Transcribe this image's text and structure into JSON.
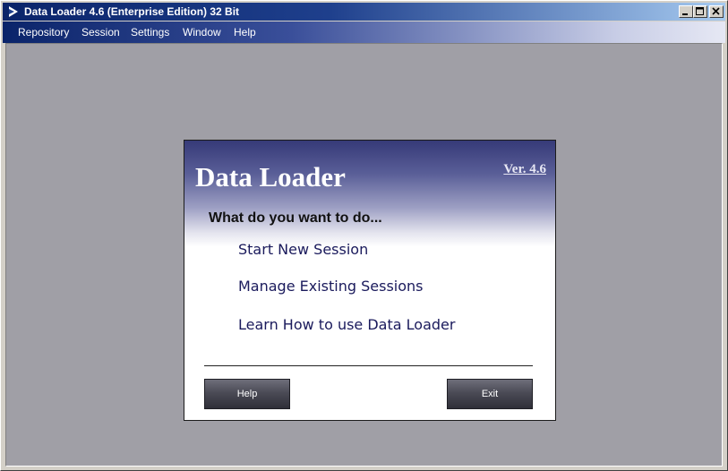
{
  "window": {
    "title": "Data Loader 4.6 (Enterprise Edition) 32 Bit",
    "controls": {
      "minimize": "_",
      "maximize": "□",
      "close": "X"
    }
  },
  "menu": [
    "Repository",
    "Session",
    "Settings",
    "Window",
    "Help"
  ],
  "dialog": {
    "title": "Data Loader",
    "version": "Ver. 4.6",
    "question": "What do you want to do...",
    "options": [
      "Start New Session",
      "Manage Existing Sessions",
      "Learn How to use Data Loader"
    ],
    "help_label": "Help",
    "exit_label": "Exit"
  }
}
